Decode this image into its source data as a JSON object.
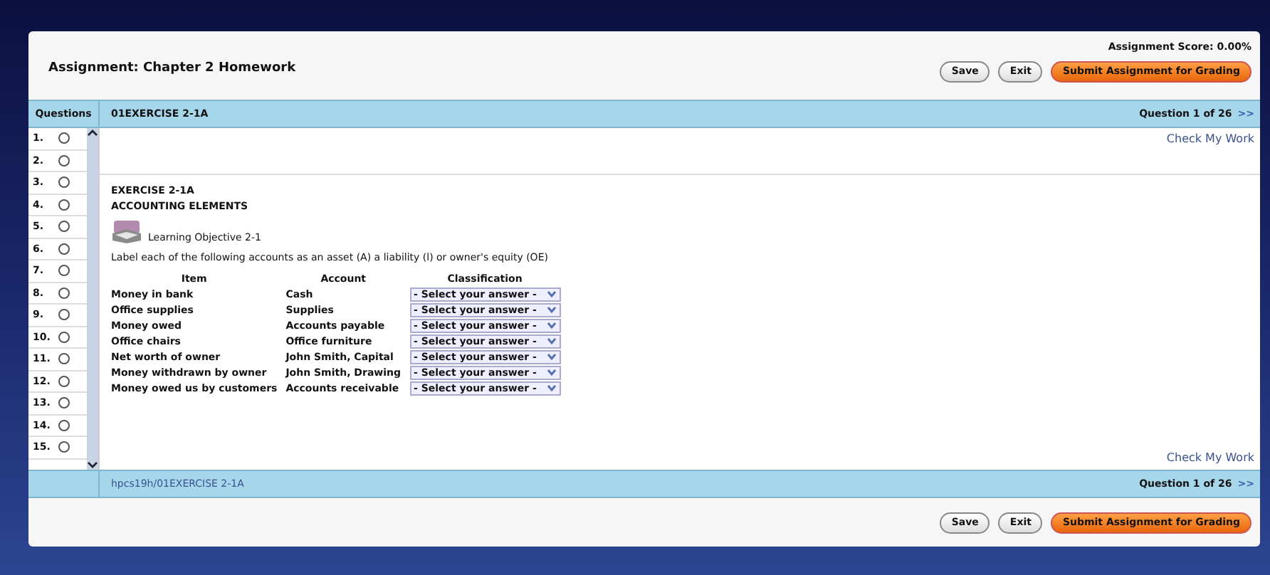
{
  "assignment": {
    "title": "Assignment: Chapter 2 Homework",
    "score": "Assignment Score: 0.00%",
    "buttons": [
      {
        "label": "Save",
        "kind": "plain"
      },
      {
        "label": "Exit",
        "kind": "plain"
      },
      {
        "label": "Submit Assignment for Grading",
        "kind": "primary"
      }
    ]
  },
  "question_bar": {
    "questions_heading": "Questions",
    "exercise": "01EXERCISE 2-1A",
    "counter": "Question 1 of 26",
    "next": ">>"
  },
  "questions": [
    {
      "number": "1.",
      "selected": false
    },
    {
      "number": "2.",
      "selected": false
    },
    {
      "number": "3.",
      "selected": false
    },
    {
      "number": "4.",
      "selected": false
    },
    {
      "number": "5.",
      "selected": false
    },
    {
      "number": "6.",
      "selected": false
    },
    {
      "number": "7.",
      "selected": false
    },
    {
      "number": "8.",
      "selected": false
    },
    {
      "number": "9.",
      "selected": false
    },
    {
      "number": "10.",
      "selected": false
    },
    {
      "number": "11.",
      "selected": false
    },
    {
      "number": "12.",
      "selected": false
    },
    {
      "number": "13.",
      "selected": false
    },
    {
      "number": "14.",
      "selected": false
    },
    {
      "number": "15.",
      "selected": false
    }
  ],
  "check_my_work": [
    "Check My Work",
    "Check My Work"
  ],
  "exercise": {
    "heading": "EXERCISE 2-1A",
    "subheading": "ACCOUNTING ELEMENTS",
    "objective": "Learning Objective 2-1",
    "instruction": "Label each of the following accounts as an asset (A) a liability (l) or owner's equity (OE)",
    "columns": [
      "Item",
      "Account",
      "Classification"
    ],
    "rows": [
      {
        "item": "Money in bank",
        "account": "Cash",
        "answer": "- Select your answer -"
      },
      {
        "item": "Office supplies",
        "account": "Supplies",
        "answer": "- Select your answer -"
      },
      {
        "item": "Money owed",
        "account": "Accounts payable",
        "answer": "- Select your answer -"
      },
      {
        "item": "Office chairs",
        "account": "Office furniture",
        "answer": "- Select your answer -"
      },
      {
        "item": "Net worth of owner",
        "account": "John Smith, Capital",
        "answer": "- Select your answer -"
      },
      {
        "item": "Money withdrawn by owner",
        "account": "John Smith, Drawing",
        "answer": "- Select your answer -"
      },
      {
        "item": "Money owed us by customers",
        "account": "Accounts receivable",
        "answer": "- Select your answer -"
      }
    ]
  },
  "footer_bar": {
    "path": "hpcs19h/01EXERCISE 2-1A",
    "counter": "Question 1 of 26",
    "next": ">>"
  },
  "footer_buttons": [
    {
      "label": "Save",
      "kind": "plain"
    },
    {
      "label": "Exit",
      "kind": "plain"
    },
    {
      "label": "Submit Assignment for Grading",
      "kind": "primary"
    }
  ]
}
